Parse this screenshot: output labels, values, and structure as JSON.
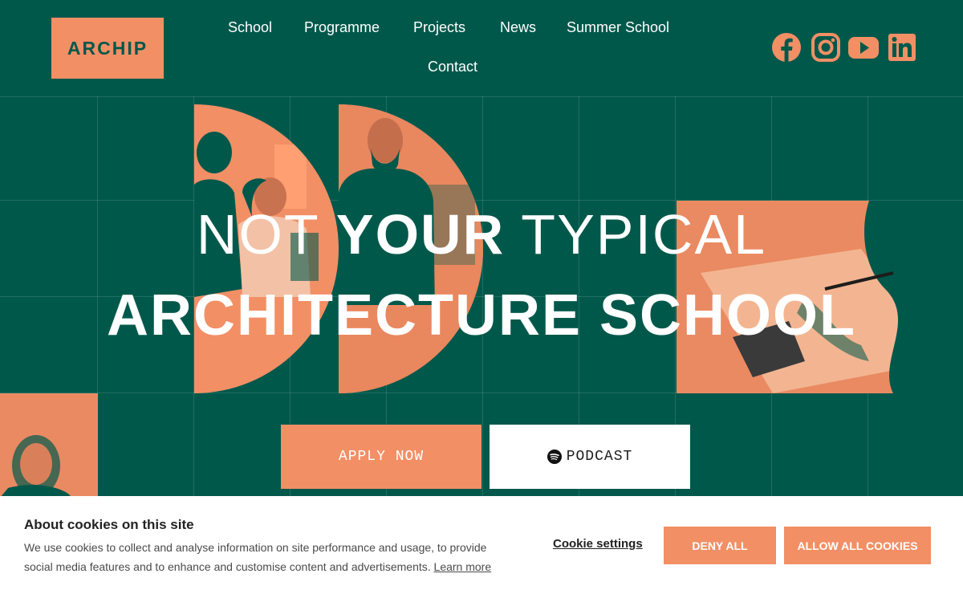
{
  "colors": {
    "brand_green": "#00584b",
    "accent_orange": "#f28f65",
    "white": "#ffffff"
  },
  "logo": {
    "text": "ARCHIP"
  },
  "nav": {
    "items": [
      {
        "label": "School"
      },
      {
        "label": "Programme"
      },
      {
        "label": "Projects"
      },
      {
        "label": "News"
      },
      {
        "label": "Summer School"
      },
      {
        "label": "Contact"
      }
    ]
  },
  "social": {
    "icons": [
      "facebook-icon",
      "instagram-icon",
      "youtube-icon",
      "linkedin-icon"
    ]
  },
  "hero": {
    "line1_light_a": "NOT ",
    "line1_bold": "YOUR",
    "line1_light_b": " TYPICAL",
    "line2": "ARCHITECTURE SCHOOL",
    "apply_label": "APPLY NOW",
    "podcast_label": "PODCAST",
    "podcast_icon": "spotify-icon"
  },
  "cookie_banner": {
    "title": "About cookies on this site",
    "text": "We use cookies to collect and analyse information on site performance and usage, to provide social media features and to enhance and customise content and advertisements.",
    "learn_more": "Learn more",
    "settings_label": "Cookie settings",
    "deny_label": "DENY ALL",
    "allow_label": "ALLOW ALL COOKIES"
  }
}
